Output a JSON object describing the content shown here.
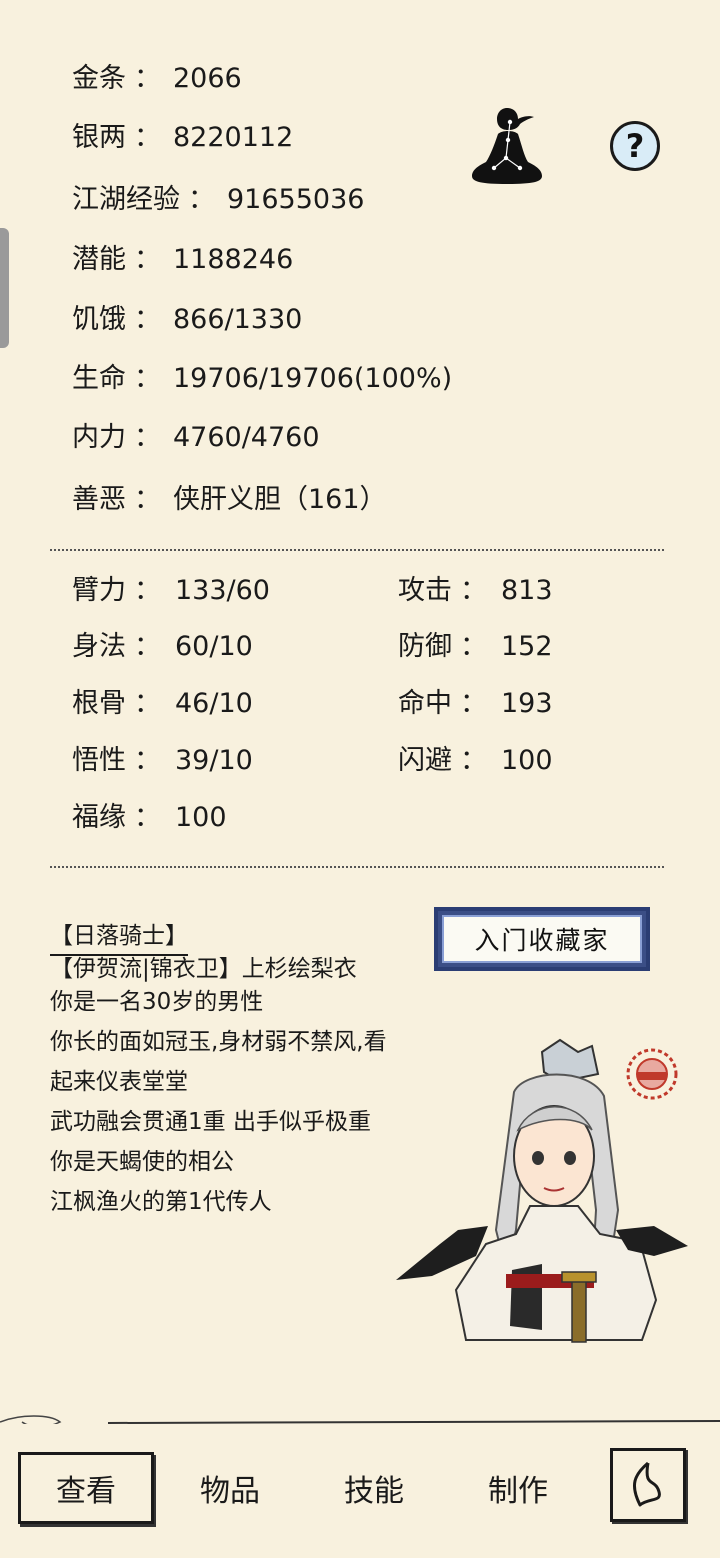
{
  "stats": [
    {
      "label": "金条",
      "value": "2066"
    },
    {
      "label": "银两",
      "value": "8220112"
    },
    {
      "label": "江湖经验",
      "value": "91655036"
    },
    {
      "label": "潜能",
      "value": "1188246"
    },
    {
      "label": "饥饿",
      "value": "866/1330"
    },
    {
      "label": "生命",
      "value": "19706/19706(100%)"
    },
    {
      "label": "内力",
      "value": "4760/4760"
    },
    {
      "label": "善恶",
      "value": "侠肝义胆（161）"
    }
  ],
  "attributes_left": [
    {
      "label": "臂力",
      "value": "133/60"
    },
    {
      "label": "身法",
      "value": "60/10"
    },
    {
      "label": "根骨",
      "value": "46/10"
    },
    {
      "label": "悟性",
      "value": "39/10"
    },
    {
      "label": "福缘",
      "value": "100"
    }
  ],
  "attributes_right": [
    {
      "label": "攻击",
      "value": "813"
    },
    {
      "label": "防御",
      "value": "152"
    },
    {
      "label": "命中",
      "value": "193"
    },
    {
      "label": "闪避",
      "value": "100"
    }
  ],
  "separator": "：",
  "icons": {
    "meditation": "meditating-figure-icon",
    "help": "question-mark-icon",
    "help_glyph": "?"
  },
  "profile": {
    "title": "【日落骑士】",
    "lines": [
      "【伊贺流|锦衣卫】上杉绘梨衣",
      "你是一名30岁的男性",
      "你长的面如冠玉,身材弱不禁风,看",
      "起来仪表堂堂",
      "武功融会贯通1重 出手似乎极重",
      "你是天蝎使的相公",
      "江枫渔火的第1代传人"
    ],
    "badge": "入门收藏家"
  },
  "tabs": [
    {
      "label": "查看",
      "active": true
    },
    {
      "label": "物品",
      "active": false
    },
    {
      "label": "技能",
      "active": false
    },
    {
      "label": "制作",
      "active": false
    }
  ],
  "colors": {
    "background": "#f8f1de",
    "text": "#1a1a1a",
    "badge_frame": "#3b4e86"
  }
}
